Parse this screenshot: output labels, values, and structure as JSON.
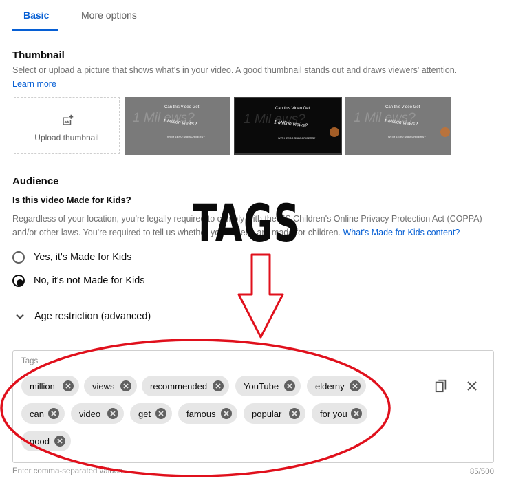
{
  "tabs": {
    "basic": "Basic",
    "more_options": "More options"
  },
  "thumbnail": {
    "title": "Thumbnail",
    "description": "Select or upload a picture that shows what's in your video. A good thumbnail stands out and draws viewers' attention.",
    "learn_more": "Learn more",
    "upload_label": "Upload thumbnail",
    "image_text": {
      "big": "1 Mil    ews?",
      "question": "Can this Video Get",
      "million": "1 Million views?",
      "small": "WITH ZERO SUBSCRIBERS?"
    }
  },
  "audience": {
    "title": "Audience",
    "question": "Is this video Made for Kids?",
    "description": "Regardless of your location, you're legally required to comply with the US Children's Online Privacy Protection Act (COPPA) and/or other laws. You're required to tell us whether your videos are made for children.",
    "link": "What's Made for Kids content?",
    "option_yes": "Yes, it's Made for Kids",
    "option_no": "No, it's not Made for Kids",
    "selected": "No, it's not Made for Kids"
  },
  "age_restriction": {
    "label": "Age restriction (advanced)"
  },
  "tags": {
    "label": "Tags",
    "items": [
      "million",
      "views",
      "recommended",
      "YouTube",
      "elderny",
      "can",
      "video",
      "get",
      "famous",
      "popular",
      "for you",
      "good"
    ],
    "hint": "Enter comma-separated values",
    "count": "85/500"
  },
  "annotation": {
    "text": "TAGS",
    "color": "#e0101c"
  },
  "icons": {
    "upload": "add-photo-icon",
    "chip_remove": "cancel-circle-icon",
    "copy": "copy-icon",
    "clear": "close-icon",
    "chevron": "chevron-down-icon"
  },
  "colors": {
    "accent": "#065fd4",
    "chip_bg": "#e6e6e6",
    "annotation": "#e0101c"
  }
}
